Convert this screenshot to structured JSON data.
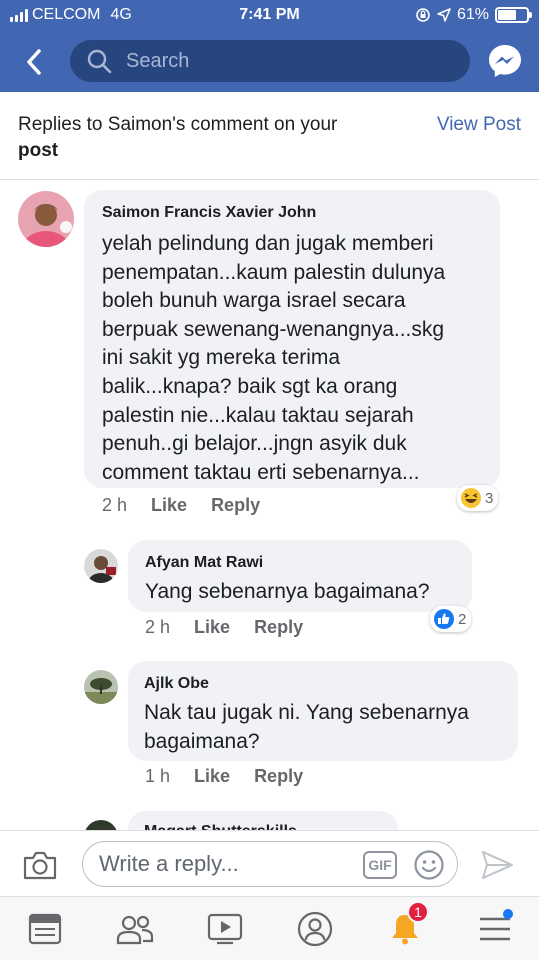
{
  "status_bar": {
    "carrier": "CELCOM",
    "network": "4G",
    "time": "7:41 PM",
    "battery": "61%",
    "battery_level": 0.61
  },
  "header": {
    "search_placeholder": "Search"
  },
  "title": {
    "line1": "Replies to Saimon's comment on your",
    "line2": "post",
    "view_post": "View Post"
  },
  "comments": [
    {
      "author": "Saimon Francis Xavier John",
      "lines": [
        "yelah pelindung dan jugak memberi",
        "penempatan...kaum palestin dulunya",
        "boleh bunuh warga israel secara",
        "berpuak sewenang-wenangnya...skg",
        "ini sakit yg mereka terima",
        "balik...knapa? baik sgt ka orang",
        "palestin nie...kalau taktau sejarah",
        "penuh..gi belajor...jngn asyik duk",
        "comment taktau erti sebenarnya..."
      ],
      "time": "2 h",
      "like": "Like",
      "reply": "Reply",
      "reaction_count": "3",
      "reaction_icon": "haha-emoji-icon"
    },
    {
      "author": "Afyan Mat Rawi",
      "lines": [
        "Yang sebenarnya bagaimana?"
      ],
      "time": "2 h",
      "like": "Like",
      "reply": "Reply",
      "reaction_count": "2",
      "reaction_icon": "like-thumb-icon"
    },
    {
      "author": "Ajlk Obe",
      "lines": [
        "Nak tau jugak ni. Yang sebenarnya",
        "bagaimana?"
      ],
      "time": "1 h",
      "like": "Like",
      "reply": "Reply"
    },
    {
      "author": "Magart Shutterskills",
      "lines": []
    }
  ],
  "composer": {
    "placeholder": "Write a reply...",
    "gif_label": "GIF"
  },
  "bottom_nav": {
    "notification_count": "1"
  },
  "colors": {
    "brand": "#4267b2",
    "bubble": "#f0f2f5",
    "badge": "#e41e3f"
  }
}
